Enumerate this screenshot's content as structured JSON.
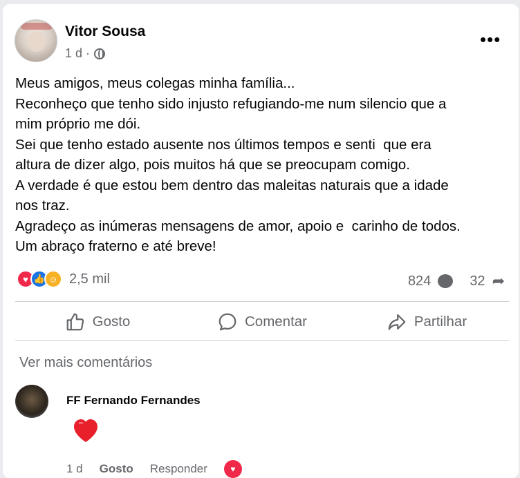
{
  "post": {
    "author": "Vitor Sousa",
    "time": "1 d ·",
    "privacy_icon": "globe-icon",
    "more_label": "•••",
    "lines": [
      "Meus amigos, meus colegas minha família...",
      "Reconheço que tenho sido injusto refugiando-me num silencio que a",
      "mim próprio me dói.",
      "Sei que tenho estado ausente nos últimos tempos e senti  que era",
      "altura de dizer algo, pois muitos há que se preocupam comigo.",
      "A verdade é que estou bem dentro das maleitas naturais que a idade",
      "nos traz.",
      "Agradeço as inúmeras mensagens de amor, apoio e  carinho de todos.",
      "Um abraço fraterno e até breve!"
    ]
  },
  "stats": {
    "reactions_count": "2,5 mil",
    "comments_count": "824",
    "shares_count": "32",
    "reaction_icons": [
      "love-icon",
      "like-icon",
      "care-icon"
    ]
  },
  "actions": {
    "like": "Gosto",
    "comment": "Comentar",
    "share": "Partilhar"
  },
  "comments": {
    "see_more": "Ver mais comentários",
    "items": [
      {
        "author": "FF Fernando Fernandes",
        "content": "heart-emoji",
        "time": "1 d",
        "like": "Gosto",
        "reply": "Responder"
      }
    ]
  },
  "colors": {
    "text": "#050505",
    "muted": "#65676b",
    "love": "#f0284a",
    "like": "#1b74e4",
    "care": "#f7b125"
  }
}
